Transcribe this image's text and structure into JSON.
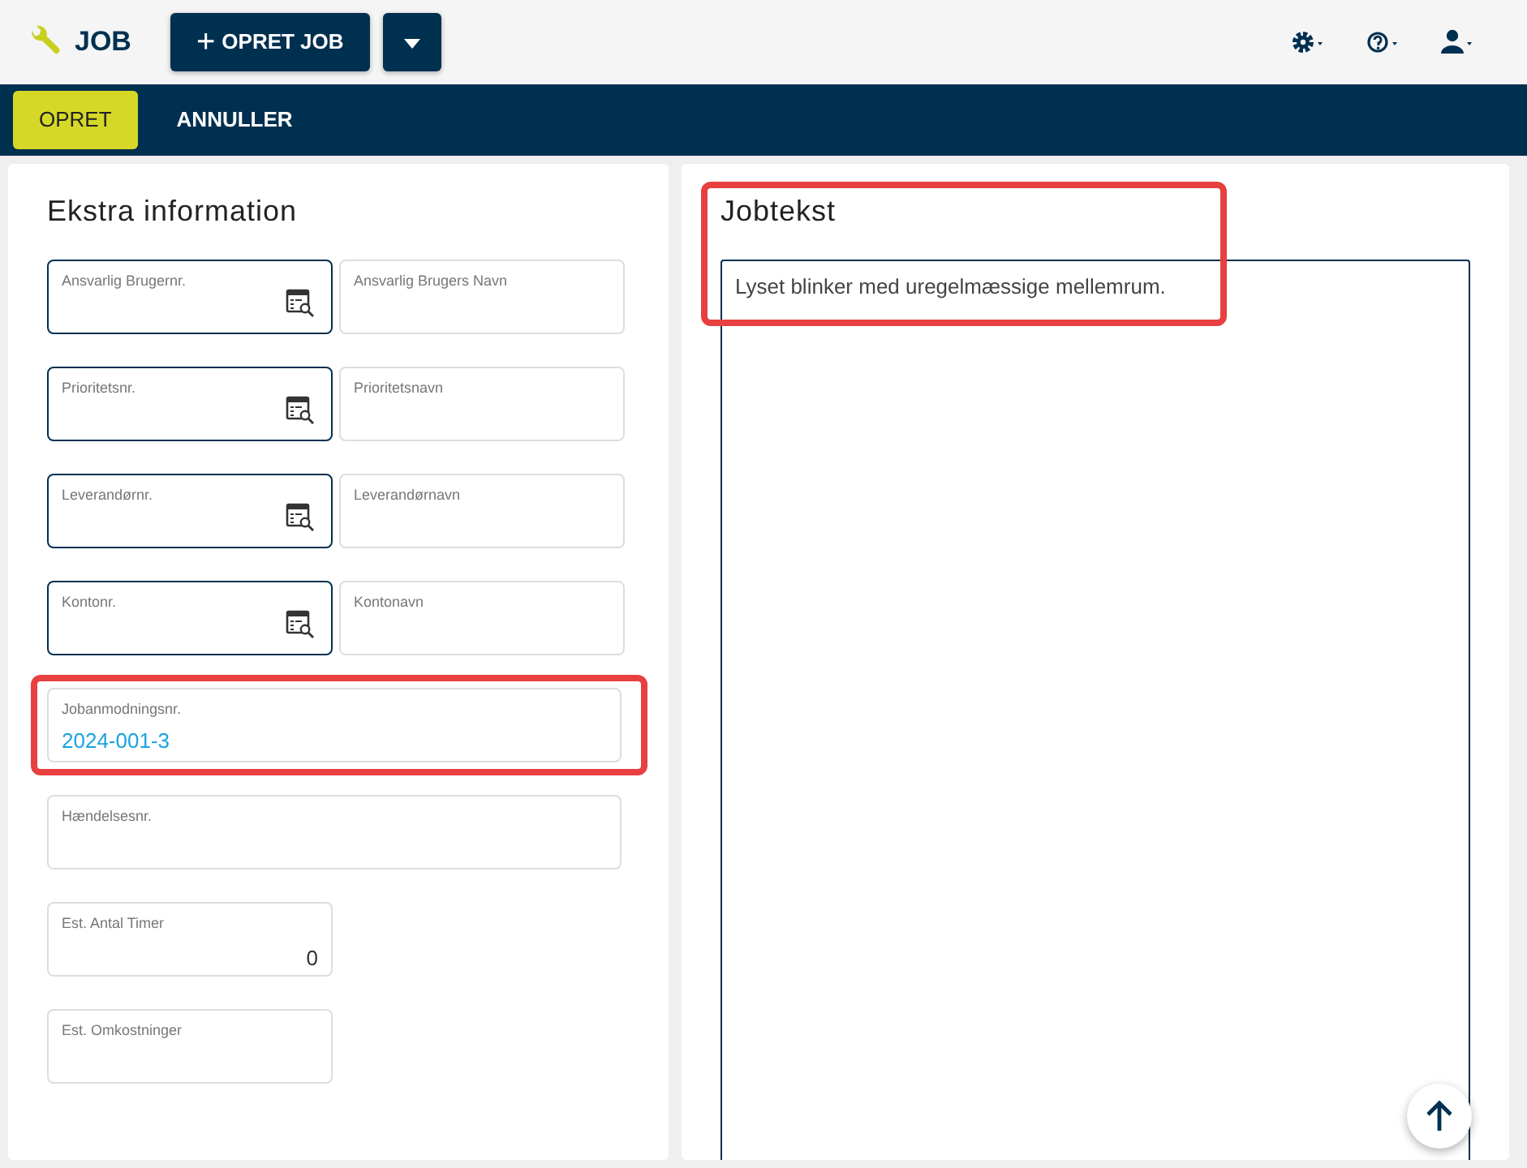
{
  "app": {
    "title": "JOB"
  },
  "toolbar": {
    "create_button": "OPRET JOB",
    "plus": "+"
  },
  "action_bar": [
    {
      "label": "OPRET",
      "selected": true
    },
    {
      "label": "ANNULLER",
      "selected": false
    }
  ],
  "extra_panel": {
    "title": "Ekstra information",
    "rows": [
      {
        "kind": "pair",
        "fields": [
          {
            "kind": "lookup",
            "label": "Ansvarlig Brugernr.",
            "highlighted": false
          },
          {
            "kind": "text",
            "label": "Ansvarlig Brugers Navn",
            "highlighted": false
          }
        ]
      },
      {
        "kind": "pair",
        "fields": [
          {
            "kind": "lookup",
            "label": "Prioritetsnr.",
            "highlighted": false
          },
          {
            "kind": "text",
            "label": "Prioritetsnavn",
            "highlighted": false
          }
        ]
      },
      {
        "kind": "pair",
        "fields": [
          {
            "kind": "lookup",
            "label": "Leverandørnr.",
            "highlighted": false
          },
          {
            "kind": "text",
            "label": "Leverandørnavn",
            "highlighted": false
          }
        ]
      },
      {
        "kind": "pair",
        "fields": [
          {
            "kind": "lookup",
            "label": "Kontonr.",
            "highlighted": false
          },
          {
            "kind": "text",
            "label": "Kontonavn",
            "highlighted": false
          }
        ]
      },
      {
        "kind": "wide",
        "fields": [
          {
            "kind": "link",
            "label": "Jobanmodningsnr.",
            "value": "2024-001-3",
            "highlighted": true
          }
        ]
      },
      {
        "kind": "wide",
        "fields": [
          {
            "kind": "text",
            "label": "Hændelsesnr.",
            "highlighted": false
          }
        ]
      },
      {
        "kind": "single",
        "fields": [
          {
            "kind": "number",
            "label": "Est. Antal Timer",
            "value": "0",
            "highlighted": false
          }
        ]
      },
      {
        "kind": "single",
        "fields": [
          {
            "kind": "text",
            "label": "Est. Omkostninger",
            "highlighted": false
          }
        ]
      }
    ]
  },
  "job_text_panel": {
    "title": "Jobtekst",
    "text": "Lyset blinker med uregelmæssige mellemrum.",
    "highlighted": true
  }
}
